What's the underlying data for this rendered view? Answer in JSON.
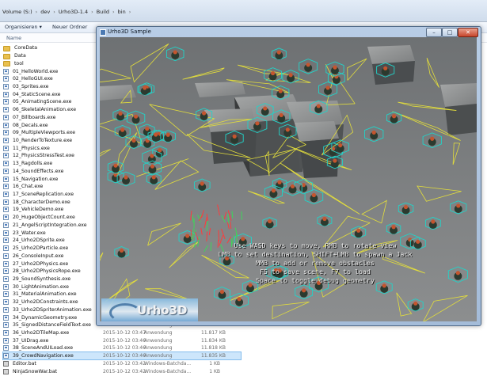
{
  "explorer": {
    "breadcrumb": [
      "Volume (S:)",
      "dev",
      "Urho3D-1.4",
      "Build",
      "bin"
    ],
    "toolbar": {
      "organize": "Organisieren ▾",
      "new_folder": "Neuer Ordner"
    },
    "columns": {
      "name": "Name"
    },
    "files": [
      {
        "name": "CoreData",
        "icon": "folder-icon"
      },
      {
        "name": "Data",
        "icon": "folder-icon"
      },
      {
        "name": "tool",
        "icon": "folder-icon"
      },
      {
        "name": "01_HelloWorld.exe",
        "icon": "exe-icon"
      },
      {
        "name": "02_HelloGUI.exe",
        "icon": "exe-icon"
      },
      {
        "name": "03_Sprites.exe",
        "icon": "exe-icon"
      },
      {
        "name": "04_StaticScene.exe",
        "icon": "exe-icon"
      },
      {
        "name": "05_AnimatingScene.exe",
        "icon": "exe-icon"
      },
      {
        "name": "06_SkeletalAnimation.exe",
        "icon": "exe-icon"
      },
      {
        "name": "07_Billboards.exe",
        "icon": "exe-icon"
      },
      {
        "name": "08_Decals.exe",
        "icon": "exe-icon"
      },
      {
        "name": "09_MultipleViewports.exe",
        "icon": "exe-icon"
      },
      {
        "name": "10_RenderToTexture.exe",
        "icon": "exe-icon"
      },
      {
        "name": "11_Physics.exe",
        "icon": "exe-icon"
      },
      {
        "name": "12_PhysicsStressTest.exe",
        "icon": "exe-icon"
      },
      {
        "name": "13_Ragdolls.exe",
        "icon": "exe-icon"
      },
      {
        "name": "14_SoundEffects.exe",
        "icon": "exe-icon"
      },
      {
        "name": "15_Navigation.exe",
        "icon": "exe-icon"
      },
      {
        "name": "16_Chat.exe",
        "icon": "exe-icon"
      },
      {
        "name": "17_SceneReplication.exe",
        "icon": "exe-icon"
      },
      {
        "name": "18_CharacterDemo.exe",
        "icon": "exe-icon"
      },
      {
        "name": "19_VehicleDemo.exe",
        "icon": "exe-icon"
      },
      {
        "name": "20_HugeObjectCount.exe",
        "icon": "exe-icon"
      },
      {
        "name": "21_AngelScriptIntegration.exe",
        "icon": "exe-icon"
      },
      {
        "name": "23_Water.exe",
        "icon": "exe-icon"
      },
      {
        "name": "24_Urho2DSprite.exe",
        "icon": "exe-icon"
      },
      {
        "name": "25_Urho2DParticle.exe",
        "icon": "exe-icon"
      },
      {
        "name": "26_ConsoleInput.exe",
        "icon": "exe-icon"
      },
      {
        "name": "27_Urho2DPhysics.exe",
        "icon": "exe-icon"
      },
      {
        "name": "28_Urho2DPhysicsRope.exe",
        "icon": "exe-icon"
      },
      {
        "name": "29_SoundSynthesis.exe",
        "icon": "exe-icon"
      },
      {
        "name": "30_LightAnimation.exe",
        "icon": "exe-icon"
      },
      {
        "name": "31_MaterialAnimation.exe",
        "icon": "exe-icon"
      },
      {
        "name": "32_Urho2DConstraints.exe",
        "icon": "exe-icon"
      },
      {
        "name": "33_Urho2DSpriterAnimation.exe",
        "icon": "exe-icon"
      },
      {
        "name": "34_DynamicGeometry.exe",
        "icon": "exe-icon"
      },
      {
        "name": "35_SignedDistanceFieldText.exe",
        "icon": "exe-icon",
        "date": "2015-10-12 03:46",
        "type": "Anwendung",
        "size": "11.813 KB"
      },
      {
        "name": "36_Urho2DTileMap.exe",
        "icon": "exe-icon",
        "date": "2015-10-12 03:47",
        "type": "Anwendung",
        "size": "11.817 KB"
      },
      {
        "name": "37_UIDrag.exe",
        "icon": "exe-icon",
        "date": "2015-10-12 03:46",
        "type": "Anwendung",
        "size": "11.834 KB"
      },
      {
        "name": "38_SceneAndUILoad.exe",
        "icon": "exe-icon",
        "date": "2015-10-12 03:46",
        "type": "Anwendung",
        "size": "11.818 KB"
      },
      {
        "name": "39_CrowdNavigation.exe",
        "icon": "exe-icon",
        "date": "2015-10-12 03:46",
        "type": "Anwendung",
        "size": "11.835 KB",
        "selected": true
      },
      {
        "name": "Editor.bat",
        "icon": "bat-icon",
        "date": "2015-10-12 03:42",
        "type": "Windows-Batchda...",
        "size": "1 KB"
      },
      {
        "name": "NinjaSnowWar.bat",
        "icon": "bat-icon",
        "date": "2015-10-12 03:42",
        "type": "Windows-Batchda...",
        "size": "1 KB"
      }
    ]
  },
  "app_window": {
    "title": "Urho3D Sample",
    "buttons": {
      "minimize": "–",
      "maximize": "□",
      "close": "✕"
    },
    "hud_lines": [
      "Use WASD keys to move, RMB to rotate view",
      "LMB to set destination, SHIFT+LMB to spawn a Jack",
      "MMB to add or remove obstacles",
      "F5 to save scene, F7 to load",
      "Space to toggle debug geometry"
    ],
    "logo_text": "Urho3D"
  },
  "colors": {
    "selection": "#cde6fb",
    "navmesh": "#e2dd3c",
    "agent_debug": "#22d3c8",
    "agent_path": "#ff3b3b"
  }
}
